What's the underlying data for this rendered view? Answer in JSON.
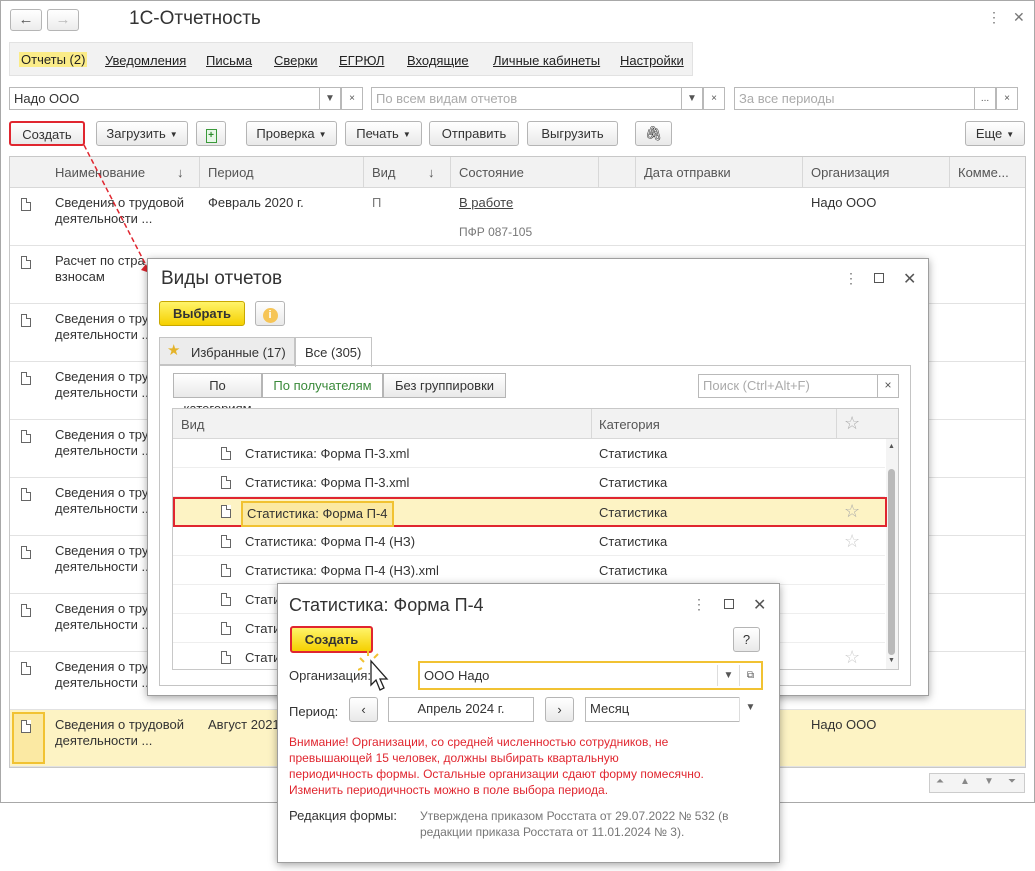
{
  "window": {
    "title": "1С-Отчетность"
  },
  "tabs": [
    "Отчеты (2)",
    "Уведомления",
    "Письма",
    "Сверки",
    "ЕГРЮЛ",
    "Входящие",
    "Личные кабинеты",
    "Настройки"
  ],
  "filters": {
    "org": "Надо ООО",
    "kind_placeholder": "По всем видам отчетов",
    "period_placeholder": "За все периоды",
    "clear": "×",
    "more": "..."
  },
  "toolbar": {
    "create": "Создать",
    "load": "Загрузить",
    "check": "Проверка",
    "print": "Печать",
    "send": "Отправить",
    "export": "Выгрузить",
    "more": "Еще"
  },
  "grid": {
    "headers": [
      "Наименование",
      "Период",
      "Вид",
      "Состояние",
      "Дата отправки",
      "Организация",
      "Комме..."
    ],
    "rows": [
      {
        "name1": "Сведения о трудовой",
        "name2": "деятельности ...",
        "period": "Февраль 2020 г.",
        "kind": "П",
        "state": "В работе",
        "state2": "ПФР 087-105",
        "org": "Надо ООО"
      },
      {
        "name1": "Расчет по стра",
        "name2": "взносам",
        "period": "",
        "kind": "",
        "state": "",
        "state2": "",
        "org": ""
      },
      {
        "name1": "Сведения о тру",
        "name2": "деятельности ..."
      },
      {
        "name1": "Сведения о тру",
        "name2": "деятельности ..."
      },
      {
        "name1": "Сведения о тру",
        "name2": "деятельности ..."
      },
      {
        "name1": "Сведения о тру",
        "name2": "деятельности ..."
      },
      {
        "name1": "Сведения о тру",
        "name2": "деятельности ..."
      },
      {
        "name1": "Сведения о тру",
        "name2": "деятельности ..."
      },
      {
        "name1": "Сведения о тру",
        "name2": "деятельности ..."
      },
      {
        "name1": "Сведения о трудовой",
        "name2": "деятельности ...",
        "period": "Август 2021",
        "org": "Надо ООО"
      }
    ]
  },
  "kinds_dialog": {
    "title": "Виды отчетов",
    "select": "Выбрать",
    "tab_fav": "Избранные (17)",
    "tab_all": "Все (305)",
    "group_btns": [
      "По категориям",
      "По получателям",
      "Без группировки"
    ],
    "search_placeholder": "Поиск (Ctrl+Alt+F)",
    "col_kind": "Вид",
    "col_cat": "Категория",
    "rows": [
      {
        "name": "Статистика: Форма П-3.xml",
        "cat": "Статистика"
      },
      {
        "name": "Статистика: Форма П-3.xml",
        "cat": "Статистика"
      },
      {
        "name": "Статистика: Форма П-4",
        "cat": "Статистика"
      },
      {
        "name": "Статистика: Форма П-4 (НЗ)",
        "cat": "Статистика"
      },
      {
        "name": "Статистика: Форма П-4 (НЗ).xml",
        "cat": "Статистика"
      },
      {
        "name": "Стати",
        "cat": ""
      },
      {
        "name": "Стати",
        "cat": ""
      },
      {
        "name": "Стати",
        "cat": ""
      }
    ]
  },
  "form_dialog": {
    "title": "Статистика: Форма П-4",
    "create": "Создать",
    "help": "?",
    "org_label": "Организация:",
    "org_value": "ООО Надо",
    "period_label": "Период:",
    "period_value": "Апрель 2024  г.",
    "periodicity": "Месяц",
    "warning": [
      "Внимание! Организации, со средней численностью сотрудников, не",
      "превышающей 15 человек, должны выбирать квартальную",
      "периодичность формы. Остальные организации сдают форму помесячно.",
      "Изменить периодичность можно в поле выбора периода."
    ],
    "edition_label": "Редакция формы:",
    "edition_value": [
      "Утверждена приказом Росстата от 29.07.2022 № 532 (в",
      "редакции приказа Росстата от 11.01.2024 № 3)."
    ]
  },
  "colors": {
    "accent": "#e0262f",
    "yellow": "#f5d000",
    "highlight": "#fdf3c4"
  }
}
